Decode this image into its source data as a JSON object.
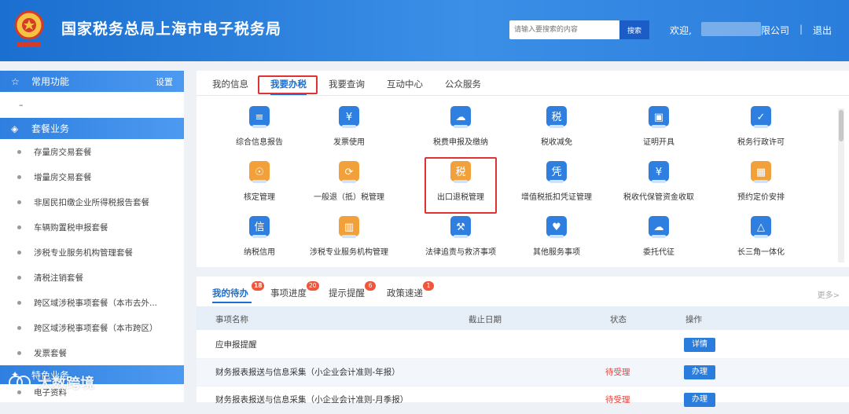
{
  "header": {
    "site_title": "国家税务总局上海市电子税务局",
    "search_placeholder": "请输入要搜索的内容",
    "search_label": "搜索",
    "welcome": "欢迎,",
    "company_suffix": "限公司",
    "separator": "|",
    "logout": "退出"
  },
  "sidebar": {
    "section1": {
      "title": "常用功能",
      "settings": "设置"
    },
    "dash": "–",
    "section2": {
      "title": "套餐业务"
    },
    "items": [
      "存量房交易套餐",
      "增量房交易套餐",
      "非居民扣缴企业所得税报告套餐",
      "车辆购置税申报套餐",
      "涉税专业服务机构管理套餐",
      "清税注销套餐",
      "跨区域涉税事项套餐（本市去外...",
      "跨区域涉税事项套餐（本市跨区）",
      "发票套餐"
    ],
    "section3": {
      "title": "特色业务"
    },
    "extra_item": "电子资料"
  },
  "main_tabs": [
    "我的信息",
    "我要办税",
    "我要查询",
    "互动中心",
    "公众服务"
  ],
  "services": [
    {
      "label": "综合信息报告",
      "icon": "report-icon"
    },
    {
      "label": "发票使用",
      "icon": "invoice-icon"
    },
    {
      "label": "税费申报及缴纳",
      "icon": "tax-payment-icon"
    },
    {
      "label": "税收减免",
      "icon": "tax-reduction-icon"
    },
    {
      "label": "证明开具",
      "icon": "certificate-icon"
    },
    {
      "label": "税务行政许可",
      "icon": "permit-icon"
    },
    {
      "label": "核定管理",
      "icon": "stamp-icon"
    },
    {
      "label": "一般退（抵）税管理",
      "icon": "refund-icon"
    },
    {
      "label": "出口退税管理",
      "icon": "export-refund-icon"
    },
    {
      "label": "增值税抵扣凭证管理",
      "icon": "voucher-icon"
    },
    {
      "label": "税收代保管资金收取",
      "icon": "custody-fund-icon"
    },
    {
      "label": "预约定价安排",
      "icon": "calendar-pricing-icon"
    },
    {
      "label": "纳税信用",
      "icon": "credit-icon"
    },
    {
      "label": "涉税专业服务机构管理",
      "icon": "agency-building-icon"
    },
    {
      "label": "法律追责与救济事项",
      "icon": "gavel-icon"
    },
    {
      "label": "其他服务事项",
      "icon": "heart-hand-icon"
    },
    {
      "label": "委托代征",
      "icon": "delegation-icon"
    },
    {
      "label": "长三角一体化",
      "icon": "triangle-network-icon"
    }
  ],
  "lower_tabs": [
    {
      "label": "我的待办",
      "badge": "18"
    },
    {
      "label": "事项进度",
      "badge": "20"
    },
    {
      "label": "提示提醒",
      "badge": "6"
    },
    {
      "label": "政策速递",
      "badge": "1"
    }
  ],
  "more": "更多>",
  "table": {
    "headers": [
      "事项名称",
      "截止日期",
      "状态",
      "操作"
    ],
    "rows": [
      {
        "name": "应申报提醒",
        "date": "",
        "status": "",
        "action": "详情"
      },
      {
        "name": "财务报表报送与信息采集（小企业会计准则-年报）",
        "date": "",
        "status": "待受理",
        "action": "办理"
      },
      {
        "name": "财务报表报送与信息采集（小企业会计准则-月季报）",
        "date": "",
        "status": "待受理",
        "action": "办理"
      }
    ]
  },
  "watermark": "大数跨境",
  "colors": {
    "primary": "#1a6fd0",
    "highlight": "#e03232",
    "badge": "#f0563c"
  }
}
